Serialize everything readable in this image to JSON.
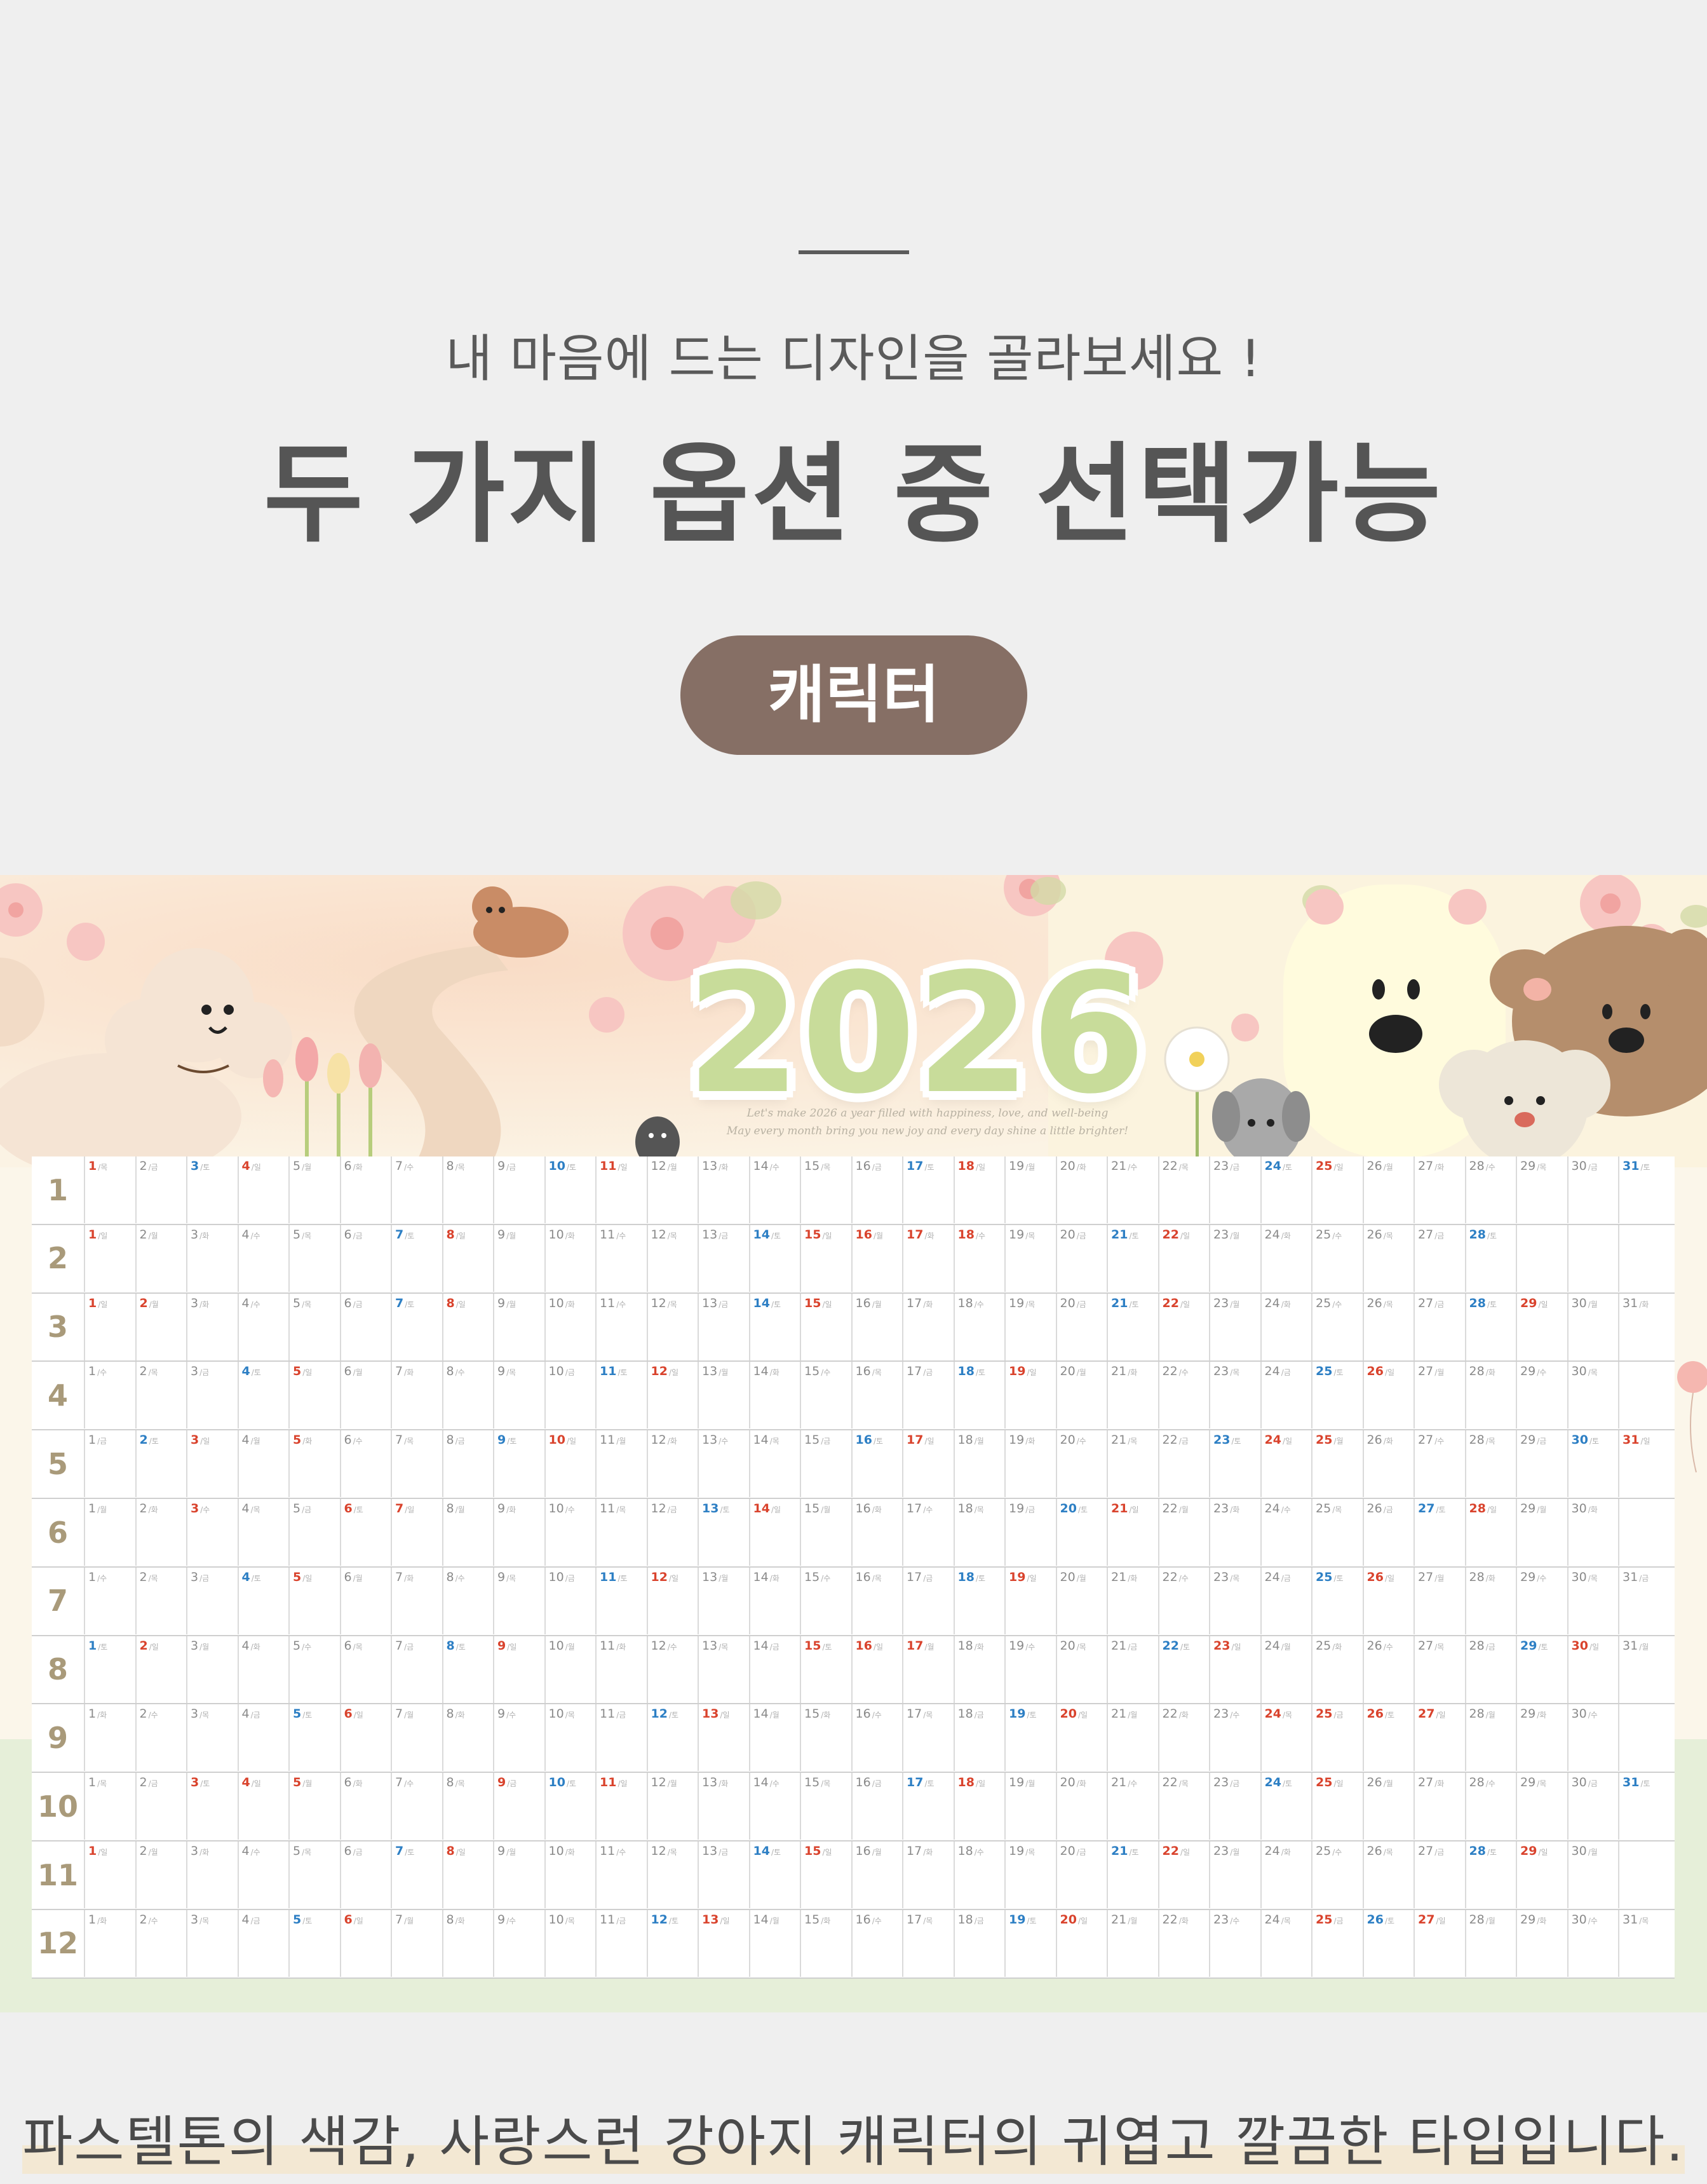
{
  "header": {
    "subtitle": "내 마음에 드는 디자인을 골라보세요 !",
    "headline": "두 가지 옵션 중 선택가능",
    "option_label": "캐릭터"
  },
  "poster": {
    "year": "2026",
    "tagline_1": "Let's make 2026 a year filled with happiness, love, and well-being",
    "tagline_2": "May every month bring you new joy and every day shine a little brighter!",
    "months": [
      {
        "label": "1",
        "days": 31,
        "start": 4,
        "holidays": [
          1
        ]
      },
      {
        "label": "2",
        "days": 28,
        "start": 0,
        "holidays": [
          16,
          17,
          18
        ]
      },
      {
        "label": "3",
        "days": 31,
        "start": 0,
        "holidays": [
          1,
          2
        ]
      },
      {
        "label": "4",
        "days": 30,
        "start": 3,
        "holidays": []
      },
      {
        "label": "5",
        "days": 31,
        "start": 5,
        "holidays": [
          5,
          24,
          25
        ]
      },
      {
        "label": "6",
        "days": 30,
        "start": 1,
        "holidays": [
          3,
          6
        ]
      },
      {
        "label": "7",
        "days": 31,
        "start": 3,
        "holidays": []
      },
      {
        "label": "8",
        "days": 31,
        "start": 6,
        "holidays": [
          15,
          17
        ]
      },
      {
        "label": "9",
        "days": 30,
        "start": 2,
        "holidays": [
          24,
          25,
          26
        ]
      },
      {
        "label": "10",
        "days": 31,
        "start": 4,
        "holidays": [
          3,
          5,
          9
        ]
      },
      {
        "label": "11",
        "days": 30,
        "start": 0,
        "holidays": []
      },
      {
        "label": "12",
        "days": 31,
        "start": 2,
        "holidays": [
          25
        ]
      }
    ],
    "weekdays": [
      "일",
      "월",
      "화",
      "수",
      "목",
      "금",
      "토"
    ]
  },
  "footer": {
    "caption": "파스텔톤의 색감, 사랑스런 강아지 캐릭터의 귀엽고 깔끔한 타입입니다."
  },
  "colors": {
    "pill": "#866f65",
    "sunday": "#d9432d",
    "saturday": "#2d7fc4",
    "year_text": "#c8dc9a"
  }
}
